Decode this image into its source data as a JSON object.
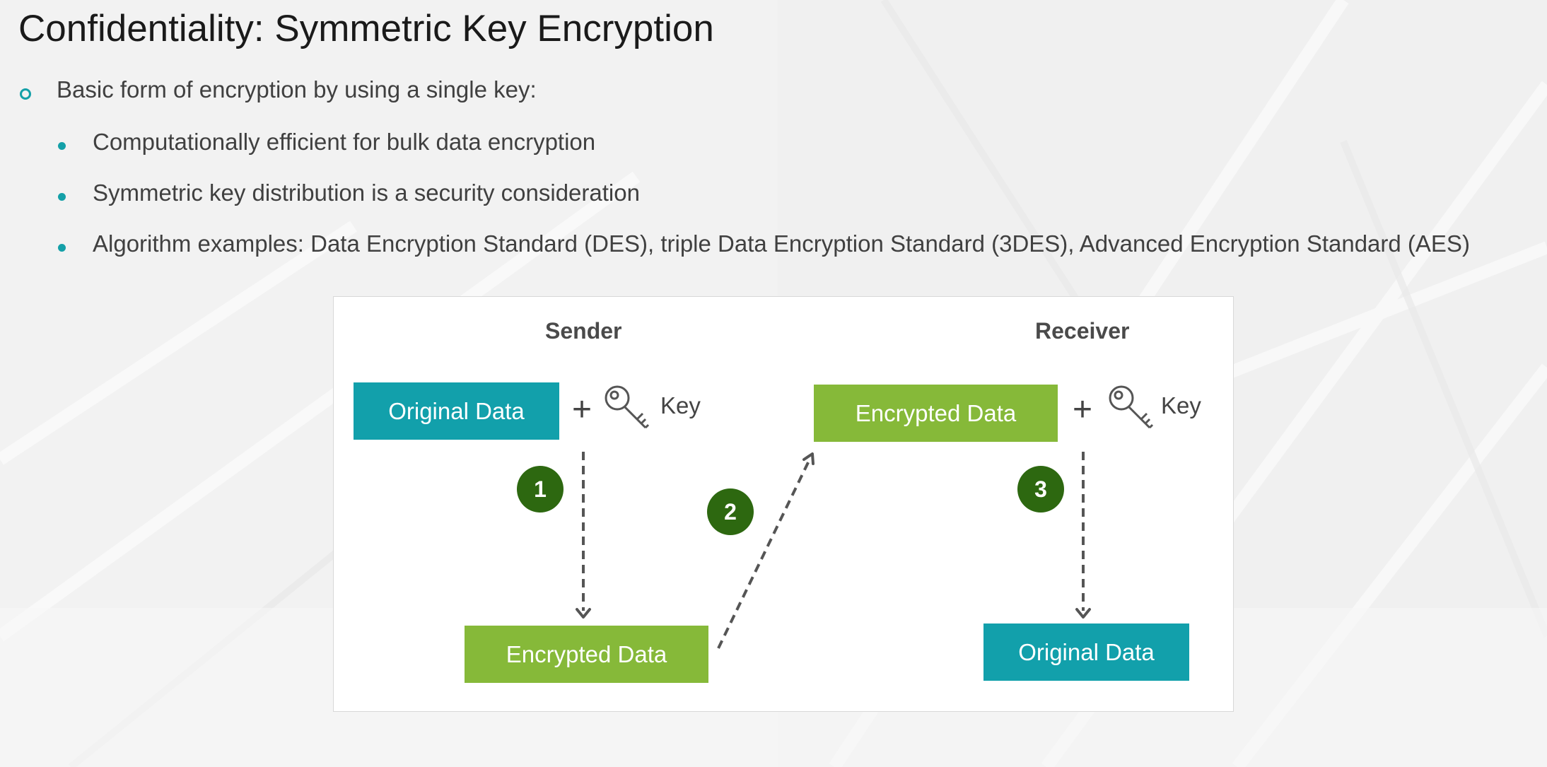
{
  "slide": {
    "title": "Confidentiality: Symmetric Key Encryption",
    "bullets": {
      "main": "Basic form of encryption by using a single key:",
      "sub": [
        "Computationally efficient for bulk data encryption",
        "Symmetric key distribution is a security consideration",
        "Algorithm examples: Data Encryption Standard (DES), triple Data Encryption Standard (3DES), Advanced Encryption Standard (AES)"
      ]
    }
  },
  "diagram": {
    "sender_label": "Sender",
    "receiver_label": "Receiver",
    "sender_original_data": "Original Data",
    "sender_encrypted_data": "Encrypted Data",
    "receiver_encrypted_data": "Encrypted Data",
    "receiver_original_data": "Original Data",
    "plus_symbol": "+",
    "key_label": "Key",
    "steps": [
      "1",
      "2",
      "3"
    ],
    "icons": {
      "key": "key-icon",
      "bullet_main": "hollow-circle-bullet",
      "bullet_sub": "filled-dot-bullet"
    },
    "colors": {
      "teal": "#12a0ab",
      "green": "#86b939",
      "step_badge": "#2d6810",
      "bullet": "#14a0a8"
    }
  }
}
